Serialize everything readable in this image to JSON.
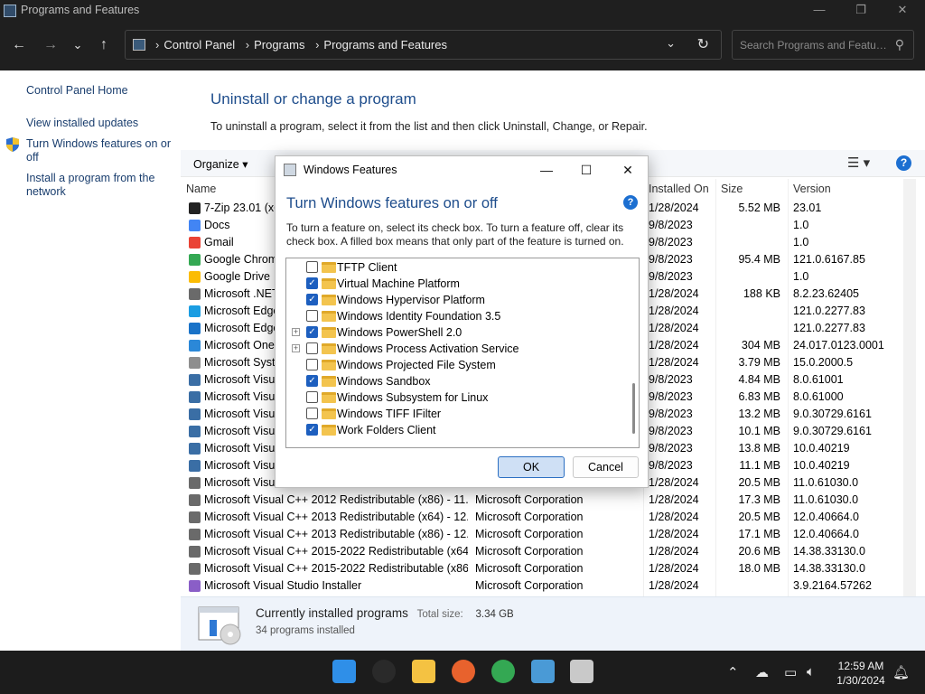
{
  "window": {
    "title": "Programs and Features",
    "controls": {
      "minimize": "—",
      "maximize": "❐",
      "close": "✕"
    }
  },
  "nav": {
    "back": "←",
    "forward": "→",
    "recent": "⌄",
    "up": "↑",
    "breadcrumbs": [
      "Control Panel",
      "Programs",
      "Programs and Features"
    ],
    "search_placeholder": "Search Programs and Featu…"
  },
  "left_pane": {
    "links": [
      "Control Panel Home",
      "View installed updates",
      "Turn Windows features on or off",
      "Install a program from the network"
    ]
  },
  "main": {
    "heading": "Uninstall or change a program",
    "subtext": "To uninstall a program, select it from the list and then click Uninstall, Change, or Repair.",
    "organize": "Organize ▾",
    "columns": {
      "name": "Name",
      "installed_on": "Installed On",
      "size": "Size",
      "version": "Version"
    },
    "rows": [
      {
        "name": "7-Zip 23.01 (x64)",
        "publisher": "",
        "date": "1/28/2024",
        "size": "5.52 MB",
        "version": "23.01",
        "icon_color": "#222222"
      },
      {
        "name": "Docs",
        "publisher": "",
        "date": "9/8/2023",
        "size": "",
        "version": "1.0",
        "icon_color": "#4285f4"
      },
      {
        "name": "Gmail",
        "publisher": "",
        "date": "9/8/2023",
        "size": "",
        "version": "1.0",
        "icon_color": "#ea4335"
      },
      {
        "name": "Google Chrome",
        "publisher": "",
        "date": "9/8/2023",
        "size": "95.4 MB",
        "version": "121.0.6167.85",
        "icon_color": "#34a853"
      },
      {
        "name": "Google Drive",
        "publisher": "",
        "date": "9/8/2023",
        "size": "",
        "version": "1.0",
        "icon_color": "#fbbc04"
      },
      {
        "name": "Microsoft .NET",
        "publisher": "",
        "date": "1/28/2024",
        "size": "188 KB",
        "version": "8.2.23.62405",
        "icon_color": "#6a6a6a"
      },
      {
        "name": "Microsoft Edge",
        "publisher": "",
        "date": "1/28/2024",
        "size": "",
        "version": "121.0.2277.83",
        "icon_color": "#1b9de2"
      },
      {
        "name": "Microsoft Edge",
        "publisher": "",
        "date": "1/28/2024",
        "size": "",
        "version": "121.0.2277.83",
        "icon_color": "#1a73c8"
      },
      {
        "name": "Microsoft OneDrive",
        "publisher": "",
        "date": "1/28/2024",
        "size": "304 MB",
        "version": "24.017.0123.0001",
        "icon_color": "#2b88d8"
      },
      {
        "name": "Microsoft System",
        "publisher": "",
        "date": "1/28/2024",
        "size": "3.79 MB",
        "version": "15.0.2000.5",
        "icon_color": "#8e8e8e"
      },
      {
        "name": "Microsoft Visual",
        "publisher": "",
        "date": "9/8/2023",
        "size": "4.84 MB",
        "version": "8.0.61001",
        "icon_color": "#3a6ea5"
      },
      {
        "name": "Microsoft Visual",
        "publisher": "",
        "date": "9/8/2023",
        "size": "6.83 MB",
        "version": "8.0.61000",
        "icon_color": "#3a6ea5"
      },
      {
        "name": "Microsoft Visual",
        "publisher": "",
        "date": "9/8/2023",
        "size": "13.2 MB",
        "version": "9.0.30729.6161",
        "icon_color": "#3a6ea5"
      },
      {
        "name": "Microsoft Visual",
        "publisher": "",
        "date": "9/8/2023",
        "size": "10.1 MB",
        "version": "9.0.30729.6161",
        "icon_color": "#3a6ea5"
      },
      {
        "name": "Microsoft Visual",
        "publisher": "",
        "date": "9/8/2023",
        "size": "13.8 MB",
        "version": "10.0.40219",
        "icon_color": "#3a6ea5"
      },
      {
        "name": "Microsoft Visual",
        "publisher": "",
        "date": "9/8/2023",
        "size": "11.1 MB",
        "version": "10.0.40219",
        "icon_color": "#3a6ea5"
      },
      {
        "name": "Microsoft Visual",
        "publisher": "",
        "date": "1/28/2024",
        "size": "20.5 MB",
        "version": "11.0.61030.0",
        "icon_color": "#6a6a6a"
      },
      {
        "name": "Microsoft Visual C++ 2012 Redistributable (x86) - 11.0...",
        "publisher": "Microsoft Corporation",
        "date": "1/28/2024",
        "size": "17.3 MB",
        "version": "11.0.61030.0",
        "icon_color": "#6a6a6a"
      },
      {
        "name": "Microsoft Visual C++ 2013 Redistributable (x64) - 12.0...",
        "publisher": "Microsoft Corporation",
        "date": "1/28/2024",
        "size": "20.5 MB",
        "version": "12.0.40664.0",
        "icon_color": "#6a6a6a"
      },
      {
        "name": "Microsoft Visual C++ 2013 Redistributable (x86) - 12.0...",
        "publisher": "Microsoft Corporation",
        "date": "1/28/2024",
        "size": "17.1 MB",
        "version": "12.0.40664.0",
        "icon_color": "#6a6a6a"
      },
      {
        "name": "Microsoft Visual C++ 2015-2022 Redistributable (x64) ...",
        "publisher": "Microsoft Corporation",
        "date": "1/28/2024",
        "size": "20.6 MB",
        "version": "14.38.33130.0",
        "icon_color": "#6a6a6a"
      },
      {
        "name": "Microsoft Visual C++ 2015-2022 Redistributable (x86) ...",
        "publisher": "Microsoft Corporation",
        "date": "1/28/2024",
        "size": "18.0 MB",
        "version": "14.38.33130.0",
        "icon_color": "#6a6a6a"
      },
      {
        "name": "Microsoft Visual Studio Installer",
        "publisher": "Microsoft Corporation",
        "date": "1/28/2024",
        "size": "",
        "version": "3.9.2164.57262",
        "icon_color": "#8a5ec7"
      }
    ]
  },
  "details": {
    "title": "Currently installed programs",
    "total_label": "Total size:",
    "total_value": "3.34 GB",
    "count": "34 programs installed"
  },
  "dialog": {
    "title": "Windows Features",
    "heading": "Turn Windows features on or off",
    "description": "To turn a feature on, select its check box. To turn a feature off, clear its check box. A filled box means that only part of the feature is turned on.",
    "features": [
      {
        "name": "TFTP Client",
        "checked": false,
        "expandable": false
      },
      {
        "name": "Virtual Machine Platform",
        "checked": true,
        "expandable": false
      },
      {
        "name": "Windows Hypervisor Platform",
        "checked": true,
        "expandable": false
      },
      {
        "name": "Windows Identity Foundation 3.5",
        "checked": false,
        "expandable": false
      },
      {
        "name": "Windows PowerShell 2.0",
        "checked": true,
        "expandable": true
      },
      {
        "name": "Windows Process Activation Service",
        "checked": false,
        "expandable": true
      },
      {
        "name": "Windows Projected File System",
        "checked": false,
        "expandable": false
      },
      {
        "name": "Windows Sandbox",
        "checked": true,
        "expandable": false
      },
      {
        "name": "Windows Subsystem for Linux",
        "checked": false,
        "expandable": false
      },
      {
        "name": "Windows TIFF IFilter",
        "checked": false,
        "expandable": false
      },
      {
        "name": "Work Folders Client",
        "checked": true,
        "expandable": false
      }
    ],
    "ok_label": "OK",
    "cancel_label": "Cancel",
    "controls": {
      "minimize": "—",
      "maximize": "☐",
      "close": "✕"
    }
  },
  "taskbar": {
    "apps": [
      {
        "name": "start",
        "color": "#2f8fe8"
      },
      {
        "name": "search",
        "color": "#2a2a2a"
      },
      {
        "name": "file-explorer",
        "color": "#f4c242"
      },
      {
        "name": "firefox",
        "color": "#e8622d"
      },
      {
        "name": "chrome",
        "color": "#34a853"
      },
      {
        "name": "control-panel",
        "color": "#4a9ad6"
      },
      {
        "name": "installer",
        "color": "#c9c9c9"
      }
    ],
    "time": "12:59 AM",
    "date": "1/30/2024"
  }
}
